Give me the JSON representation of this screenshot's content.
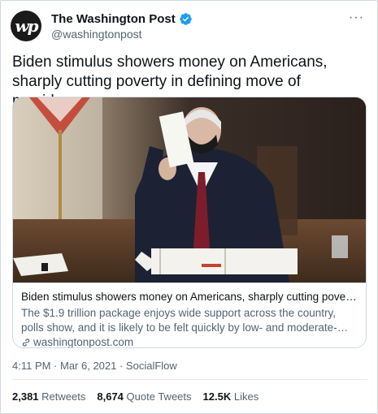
{
  "account": {
    "name": "The Washington Post",
    "handle": "@washingtonpost",
    "avatar_text": "wp",
    "verified": true,
    "accent_color": "#1d9bf0"
  },
  "tweet": {
    "text": "Biden stimulus showers money on Americans, sharply cutting poverty in defining move of presidency",
    "timestamp": "4:11 PM · Mar 6, 2021 · SocialFlow"
  },
  "card": {
    "title": "Biden stimulus showers money on Americans, sharply cutting poverty in d...",
    "description": "The $1.9 trillion package enjoys wide support across the country, polls show, and it is likely to be felt quickly by low- and moderate-income ...",
    "domain": "washingtonpost.com"
  },
  "stats": {
    "retweets_count": "2,381",
    "retweets_label": "Retweets",
    "quotes_count": "8,674",
    "quotes_label": "Quote Tweets",
    "likes_count": "12.5K",
    "likes_label": "Likes"
  },
  "icons": [
    "verified-badge-icon",
    "more-options-icon",
    "link-icon"
  ]
}
